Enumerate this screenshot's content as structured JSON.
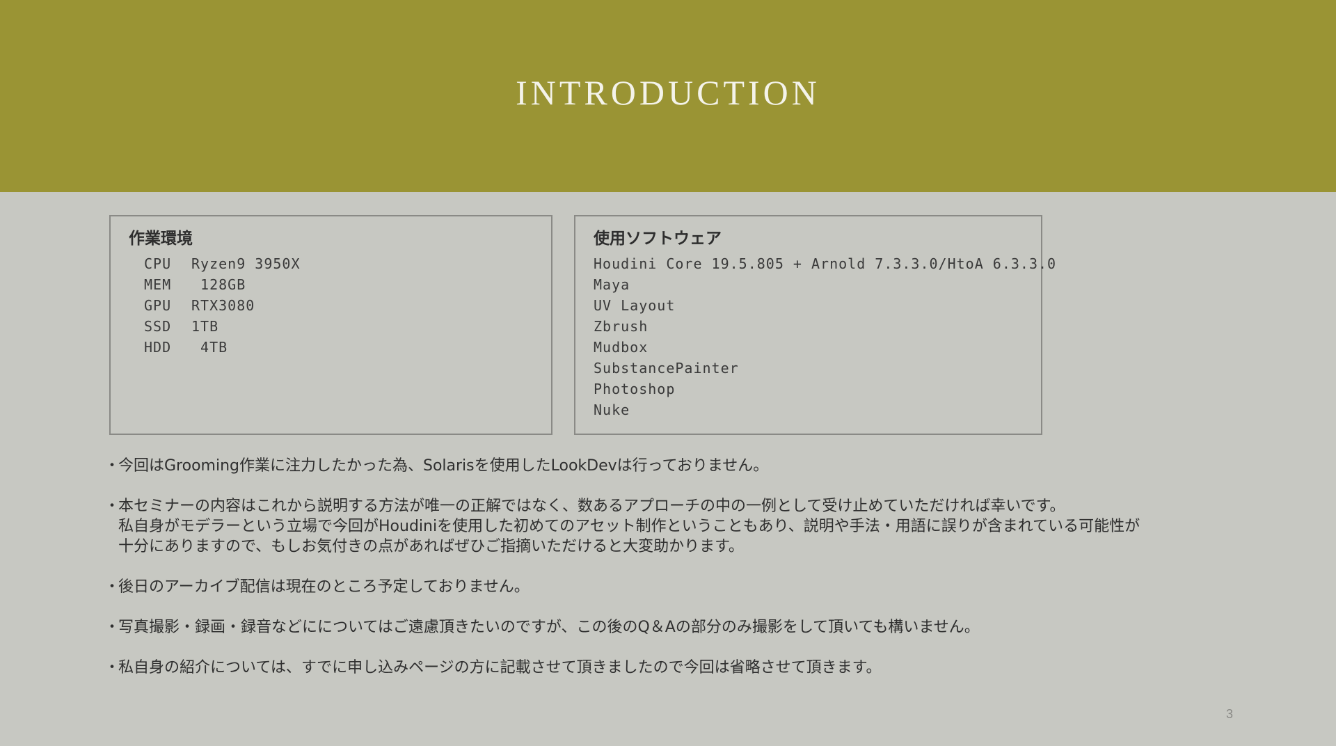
{
  "header": {
    "title": "INTRODUCTION"
  },
  "env": {
    "title": "作業環境",
    "specs": [
      {
        "label": "CPU",
        "value": "Ryzen9 3950X"
      },
      {
        "label": "MEM",
        "value": " 128GB"
      },
      {
        "label": "GPU",
        "value": "RTX3080"
      },
      {
        "label": "SSD",
        "value": "1TB"
      },
      {
        "label": "HDD",
        "value": " 4TB"
      }
    ]
  },
  "software": {
    "title": "使用ソフトウェア",
    "items": [
      "Houdini Core 19.5.805 + Arnold 7.3.3.0/HtoA 6.3.3.0",
      "Maya",
      "UV Layout",
      "Zbrush",
      "Mudbox",
      "SubstancePainter",
      "Photoshop",
      "Nuke"
    ]
  },
  "notes": {
    "bullet": "・",
    "n1": {
      "l1": "今回はGrooming作業に注力したかった為、Solarisを使用したLookDevは行っておりません。"
    },
    "n2": {
      "l1": "本セミナーの内容はこれから説明する方法が唯一の正解ではなく、数あるアプローチの中の一例として受け止めていただければ幸いです。",
      "l2": "私自身がモデラーという立場で今回がHoudiniを使用した初めてのアセット制作ということもあり、説明や手法・用語に誤りが含まれている可能性が",
      "l3": "十分にありますので、もしお気付きの点があればぜひご指摘いただけると大変助かります。"
    },
    "n3": {
      "l1": "後日のアーカイブ配信は現在のところ予定しておりません。"
    },
    "n4": {
      "l1": "写真撮影・録画・録音などにについてはご遠慮頂きたいのですが、この後のQ＆Aの部分のみ撮影をして頂いても構いません。"
    },
    "n5": {
      "l1": "私自身の紹介については、すでに申し込みページの方に記載させて頂きましたので今回は省略させて頂きます。"
    }
  },
  "footer": {
    "page_number": "3"
  }
}
